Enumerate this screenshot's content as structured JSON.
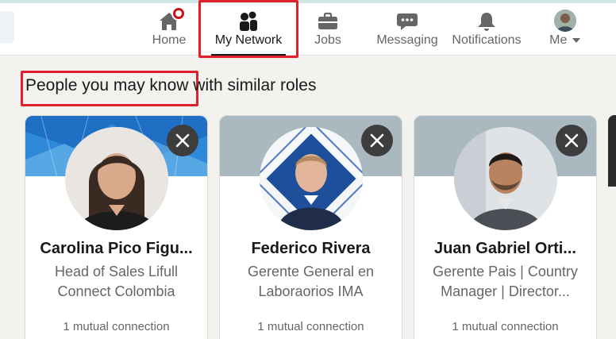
{
  "nav": {
    "items": [
      {
        "key": "home",
        "label": "Home",
        "icon": "home-icon"
      },
      {
        "key": "network",
        "label": "My Network",
        "icon": "people-icon",
        "active": true
      },
      {
        "key": "jobs",
        "label": "Jobs",
        "icon": "briefcase-icon"
      },
      {
        "key": "messaging",
        "label": "Messaging",
        "icon": "chat-icon"
      },
      {
        "key": "notifications",
        "label": "Notifications",
        "icon": "bell-icon"
      },
      {
        "key": "me",
        "label": "Me",
        "icon": "avatar"
      }
    ]
  },
  "section": {
    "title": "People you may know with similar roles"
  },
  "cards": [
    {
      "name": "Carolina Pico Figu...",
      "headline_line1": "Head of Sales Lifull",
      "headline_line2": "Connect Colombia",
      "mutual": "1 mutual connection"
    },
    {
      "name": "Federico Rivera",
      "headline_line1": "Gerente General en",
      "headline_line2": "Laboraorios IMA",
      "mutual": "1 mutual connection"
    },
    {
      "name": "Juan Gabriel Orti...",
      "headline_line1": "Gerente Pais | Country",
      "headline_line2": "Manager | Director...",
      "mutual": "1 mutual connection"
    }
  ],
  "colors": {
    "highlight": "#e0202c",
    "notification_badge": "#cc1016",
    "dismiss_button": "#3d3d3d",
    "banner_blue": "#2d7fd6",
    "banner_grey": "#a9b9bf"
  }
}
